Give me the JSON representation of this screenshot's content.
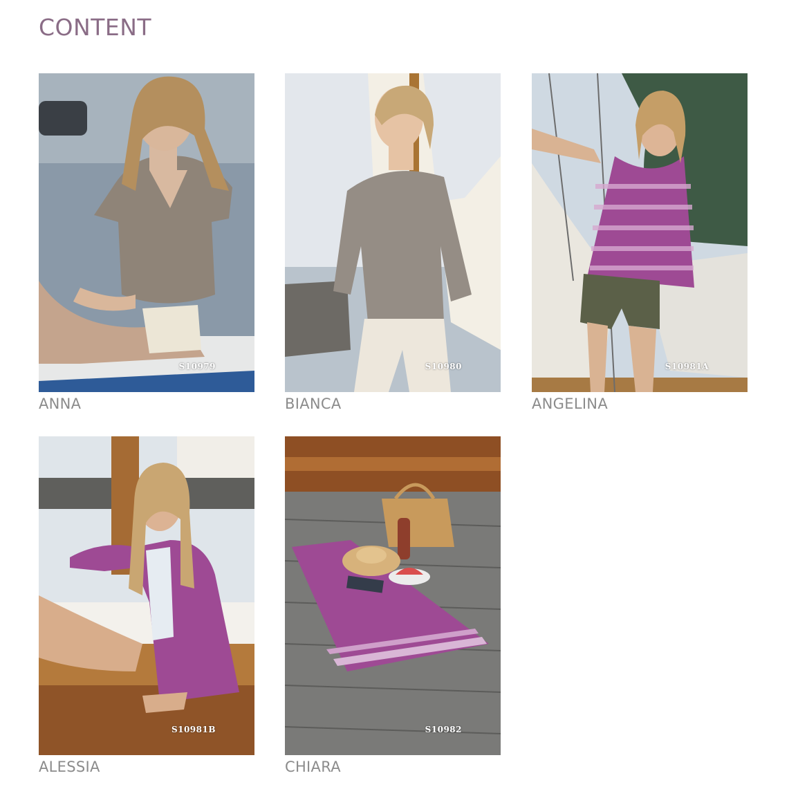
{
  "page": {
    "title": "CONTENT"
  },
  "items": [
    {
      "name": "ANNA",
      "code": "S10979",
      "garment": "grey short-sleeve v-neck sweater"
    },
    {
      "name": "BIANCA",
      "code": "S10980",
      "garment": "grey long-sleeve sweater"
    },
    {
      "name": "ANGELINA",
      "code": "S10981A",
      "garment": "purple striped tank top"
    },
    {
      "name": "ALESSIA",
      "code": "S10981B",
      "garment": "purple cardigan"
    },
    {
      "name": "CHIARA",
      "code": "S10982",
      "garment": "purple striped blanket"
    }
  ],
  "colors": {
    "title": "#8a6c86",
    "caption": "#8b8b8b",
    "purple_knit": "#9e4a94",
    "grey_knit": "#8f8478"
  }
}
